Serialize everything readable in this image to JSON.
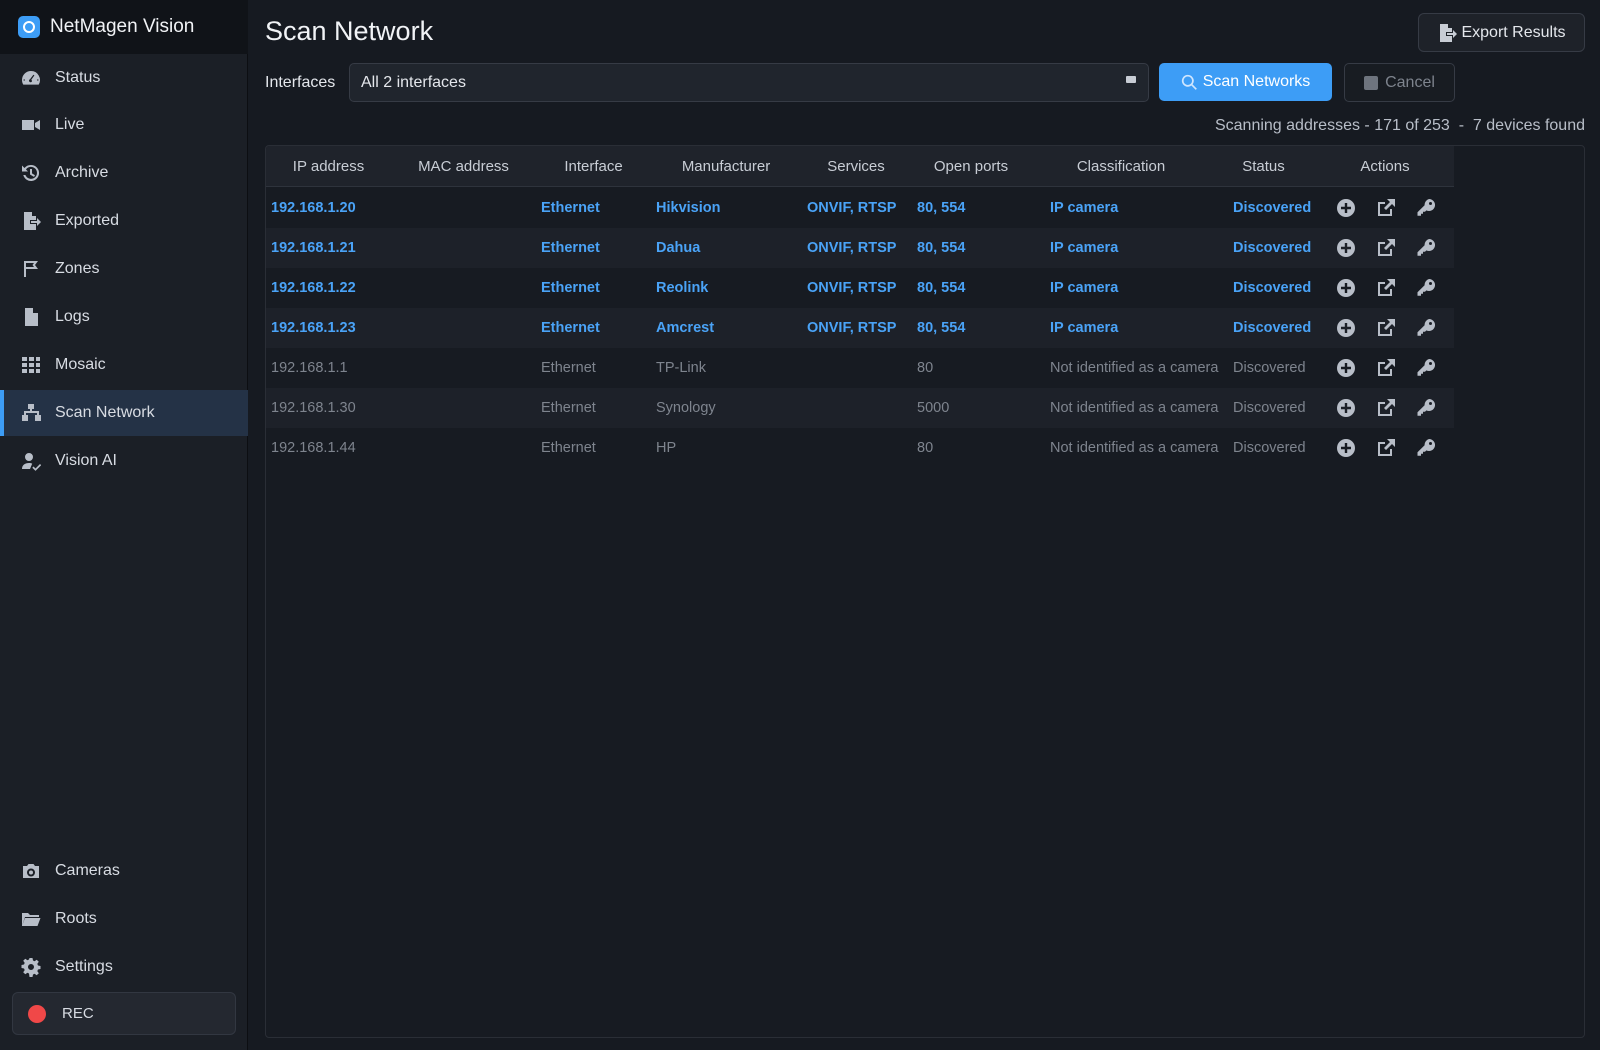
{
  "app": {
    "title": "NetMagen Vision"
  },
  "sidebar": {
    "items": [
      {
        "label": "Status",
        "icon": "gauge-icon"
      },
      {
        "label": "Live",
        "icon": "video-icon"
      },
      {
        "label": "Archive",
        "icon": "history-icon"
      },
      {
        "label": "Exported",
        "icon": "file-export-icon"
      },
      {
        "label": "Zones",
        "icon": "zone-flag-icon"
      },
      {
        "label": "Logs",
        "icon": "document-icon"
      },
      {
        "label": "Mosaic",
        "icon": "grid-icon"
      },
      {
        "label": "Scan Network",
        "icon": "network-icon",
        "active": true
      },
      {
        "label": "Vision AI",
        "icon": "user-check-icon"
      }
    ],
    "bottom_items": [
      {
        "label": "Cameras",
        "icon": "camera-icon"
      },
      {
        "label": "Roots",
        "icon": "folder-icon"
      },
      {
        "label": "Settings",
        "icon": "gear-icon"
      }
    ],
    "rec_label": "REC"
  },
  "main": {
    "title": "Scan Network",
    "export_label": "Export Results",
    "interfaces_label": "Interfaces",
    "interfaces_value": "All 2 interfaces",
    "scan_label": "Scan Networks",
    "cancel_label": "Cancel",
    "progress_text": "Scanning addresses - 171 of 253  -  7 devices found"
  },
  "table": {
    "headers": [
      "IP address",
      "MAC address",
      "Interface",
      "Manufacturer",
      "Services",
      "Open ports",
      "Classification",
      "Status",
      "Actions"
    ],
    "rows": [
      {
        "ip": "192.168.1.20",
        "mac": "",
        "iface": "Ethernet",
        "mfr": "Hikvision",
        "services": "ONVIF, RTSP",
        "ports": "80, 554",
        "class": "IP camera",
        "status": "Discovered",
        "camera": true
      },
      {
        "ip": "192.168.1.21",
        "mac": "",
        "iface": "Ethernet",
        "mfr": "Dahua",
        "services": "ONVIF, RTSP",
        "ports": "80, 554",
        "class": "IP camera",
        "status": "Discovered",
        "camera": true
      },
      {
        "ip": "192.168.1.22",
        "mac": "",
        "iface": "Ethernet",
        "mfr": "Reolink",
        "services": "ONVIF, RTSP",
        "ports": "80, 554",
        "class": "IP camera",
        "status": "Discovered",
        "camera": true
      },
      {
        "ip": "192.168.1.23",
        "mac": "",
        "iface": "Ethernet",
        "mfr": "Amcrest",
        "services": "ONVIF, RTSP",
        "ports": "80, 554",
        "class": "IP camera",
        "status": "Discovered",
        "camera": true
      },
      {
        "ip": "192.168.1.1",
        "mac": "",
        "iface": "Ethernet",
        "mfr": "TP-Link",
        "services": "",
        "ports": "80",
        "class": "Not identified as a camera",
        "status": "Discovered",
        "camera": false
      },
      {
        "ip": "192.168.1.30",
        "mac": "",
        "iface": "Ethernet",
        "mfr": "Synology",
        "services": "",
        "ports": "5000",
        "class": "Not identified as a camera",
        "status": "Discovered",
        "camera": false
      },
      {
        "ip": "192.168.1.44",
        "mac": "",
        "iface": "Ethernet",
        "mfr": "HP",
        "services": "",
        "ports": "80",
        "class": "Not identified as a camera",
        "status": "Discovered",
        "camera": false
      }
    ]
  },
  "colors": {
    "accent": "#3d9df6",
    "rec": "#f04848",
    "camera_text": "#4aa3f7"
  }
}
